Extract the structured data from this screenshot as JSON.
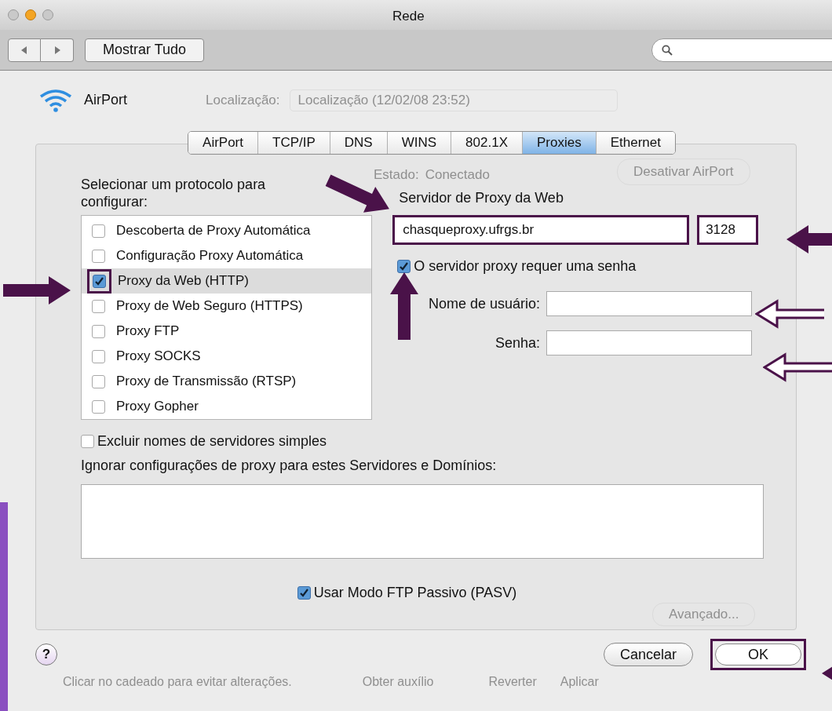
{
  "window": {
    "title": "Rede"
  },
  "toolbar": {
    "show_all": "Mostrar Tudo"
  },
  "service": {
    "name": "AirPort"
  },
  "background_window": {
    "location_label": "Localização:",
    "location_value": "Localização (12/02/08 23:52)",
    "status_label": "Estado:",
    "status_value": "Conectado",
    "disable_button": "Desativar AirPort",
    "advanced_button": "Avançado...",
    "lock_text": "Clicar no cadeado para evitar alterações.",
    "assist_button": "Obter auxílio",
    "revert_button": "Reverter",
    "apply_button": "Aplicar"
  },
  "tabs": [
    {
      "label": "AirPort",
      "selected": false
    },
    {
      "label": "TCP/IP",
      "selected": false
    },
    {
      "label": "DNS",
      "selected": false
    },
    {
      "label": "WINS",
      "selected": false
    },
    {
      "label": "802.1X",
      "selected": false
    },
    {
      "label": "Proxies",
      "selected": true
    },
    {
      "label": "Ethernet",
      "selected": false
    }
  ],
  "protocols": {
    "label": "Selecionar um protocolo para configurar:",
    "items": [
      {
        "label": "Descoberta de Proxy Automática",
        "checked": false,
        "selected": false
      },
      {
        "label": "Configuração Proxy Automática",
        "checked": false,
        "selected": false
      },
      {
        "label": "Proxy da Web (HTTP)",
        "checked": true,
        "selected": true
      },
      {
        "label": "Proxy de Web Seguro (HTTPS)",
        "checked": false,
        "selected": false
      },
      {
        "label": "Proxy FTP",
        "checked": false,
        "selected": false
      },
      {
        "label": "Proxy SOCKS",
        "checked": false,
        "selected": false
      },
      {
        "label": "Proxy de Transmissão (RTSP)",
        "checked": false,
        "selected": false
      },
      {
        "label": "Proxy Gopher",
        "checked": false,
        "selected": false
      }
    ]
  },
  "proxy_server": {
    "label": "Servidor de Proxy da Web",
    "host": "chasqueproxy.ufrgs.br",
    "port": "3128",
    "requires_password": {
      "label": "O servidor proxy requer uma senha",
      "checked": true
    },
    "username_label": "Nome de usuário:",
    "password_label": "Senha:"
  },
  "exclude_simple": {
    "label": "Excluir nomes de servidores simples",
    "checked": false
  },
  "bypass": {
    "label": "Ignorar configurações de proxy para estes Servidores e Domínios:"
  },
  "passive_ftp": {
    "label": "Usar Modo FTP Passivo (PASV)",
    "checked": true
  },
  "buttons": {
    "help": "?",
    "cancel": "Cancelar",
    "ok": "OK"
  }
}
